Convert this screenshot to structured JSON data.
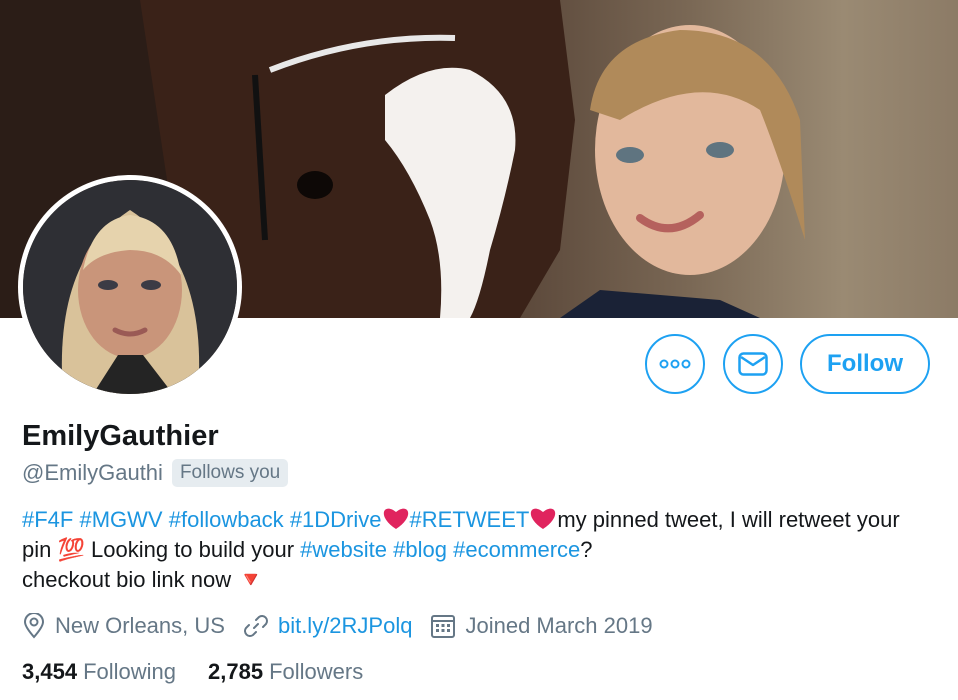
{
  "profile": {
    "display_name": "EmilyGauthier",
    "handle": "@EmilyGauthi",
    "follows_you_badge": "Follows you"
  },
  "actions": {
    "more_icon": "more-dots-icon",
    "message_icon": "envelope-icon",
    "follow_label": "Follow"
  },
  "bio": {
    "tags1": [
      "#F4F",
      "#MGWV",
      "#followback",
      "#1DDrive"
    ],
    "tag2": "#RETWEET",
    "text1": "my pinned tweet, I will retweet your pin",
    "emoji_100": "💯",
    "text2": "Looking to build your",
    "tags2": [
      "#website",
      "#blog",
      "#ecommerce"
    ],
    "text3": "?",
    "text4": "checkout bio link now",
    "triangle": "🔻"
  },
  "meta": {
    "location": "New Orleans, US",
    "link": "bit.ly/2RJPolq",
    "joined": "Joined March 2019"
  },
  "stats": {
    "following_count": "3,454",
    "following_label": "Following",
    "followers_count": "2,785",
    "followers_label": "Followers"
  },
  "colors": {
    "accent": "#1da1f2",
    "link": "#1b95e0",
    "muted": "#657786",
    "heart": "#e0245e"
  }
}
